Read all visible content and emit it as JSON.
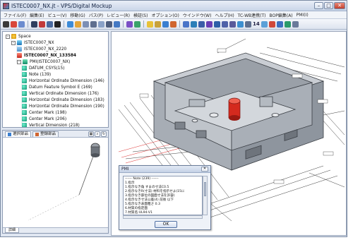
{
  "window": {
    "title": "ISTEC0007_NX.jt - VPS/Digital Mockup",
    "controls": {
      "minimize": "–",
      "maximize": "□",
      "close": "✕"
    }
  },
  "menu": {
    "items": [
      "ファイル(F)",
      "編集(E)",
      "ビュー(V)",
      "移動(G)",
      "パス(P)",
      "レビュー(R)",
      "検証(S)",
      "オプション(O)",
      "ウインドウ(W)",
      "ヘルプ(H)",
      "TC-WB連携(T)",
      "BOP編集(A)",
      "PMI(I)"
    ]
  },
  "toolbar": {
    "counter": "14"
  },
  "tree": {
    "rows": [
      {
        "label": "Space",
        "icon": "space-icon",
        "expander": "–",
        "bold": false
      },
      {
        "label": "ISTEC0007_NX",
        "icon": "assembly-icon",
        "expander": "–",
        "bold": false
      },
      {
        "label": "ISTEC0007_NX_2220",
        "icon": "part-icon",
        "expander": "",
        "bold": false
      },
      {
        "label": "ISTEC0007_NX_133584",
        "icon": "red-part-icon",
        "expander": "",
        "bold": true
      },
      {
        "label": "PMI(ISTEC0007_NX)",
        "icon": "pmi-icon",
        "expander": "–",
        "bold": false
      },
      {
        "label": "DATUM_CSYS(15)",
        "icon": "pmi-leaf-icon",
        "expander": "",
        "bold": false
      },
      {
        "label": "Note (139)",
        "icon": "pmi-leaf-icon",
        "expander": "",
        "bold": false
      },
      {
        "label": "Horizontal Ordinate Dimension (146)",
        "icon": "pmi-leaf-icon",
        "expander": "",
        "bold": false
      },
      {
        "label": "Datum Feature Symbol E (169)",
        "icon": "pmi-leaf-icon",
        "expander": "",
        "bold": false
      },
      {
        "label": "Vertical Ordinate Dimension (176)",
        "icon": "pmi-leaf-icon",
        "expander": "",
        "bold": false
      },
      {
        "label": "Horizontal Ordinate Dimension (183)",
        "icon": "pmi-leaf-icon",
        "expander": "",
        "bold": false
      },
      {
        "label": "Horizontal Ordinate Dimension (190)",
        "icon": "pmi-leaf-icon",
        "expander": "",
        "bold": false
      },
      {
        "label": "Center Mark (198)",
        "icon": "pmi-leaf-icon",
        "expander": "",
        "bold": false
      },
      {
        "label": "Center Mark (206)",
        "icon": "pmi-leaf-icon",
        "expander": "",
        "bold": false
      },
      {
        "label": "Vertical Dimension (218)",
        "icon": "pmi-leaf-icon",
        "expander": "",
        "bold": false
      }
    ]
  },
  "preview": {
    "tabs": [
      "選択部品",
      "登録部品"
    ],
    "bottom_tab": "詳細"
  },
  "pmi_dialog": {
    "title": "PMI",
    "close": "✕",
    "lines": [
      "------ Note (239) ------",
      "1.指示",
      "1.指示なき角 すまの寸法C0.5",
      "2.指示なきR(寸法) 材料を指示せよ(15に",
      "3.指示なき部位の図面寸法を許容(",
      "4.指示なき寸法公差(4) 前後 以下",
      "5.指示なき表面粗さ 0.3",
      "6.材質の指定面",
      "7.材質名:UL94-V1"
    ],
    "ok_label": "OK"
  },
  "colors": {
    "accent_red": "#d42a1e",
    "model_gray": "#b9bec6",
    "dimension_line": "#333333",
    "highlight_red": "#e04040"
  }
}
